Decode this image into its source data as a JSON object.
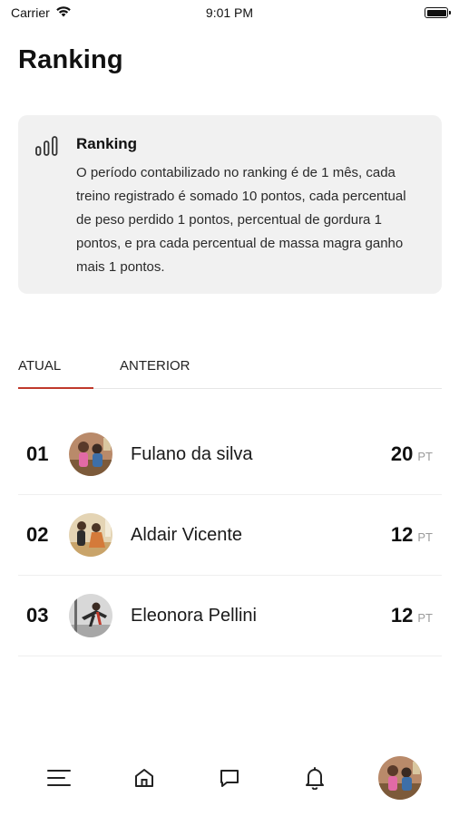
{
  "status_bar": {
    "carrier": "Carrier",
    "time": "9:01 PM"
  },
  "header": {
    "title": "Ranking"
  },
  "info_card": {
    "icon": "bar-chart-icon",
    "title": "Ranking",
    "body": "O período contabilizado no ranking é de 1 mês, cada treino registrado é somado 10 pontos, cada percentual de peso perdido 1 pontos, percentual de gordura 1 pontos, e pra cada percentual de massa magra ganho mais 1 pontos."
  },
  "tabs": [
    {
      "label": "ATUAL",
      "active": true
    },
    {
      "label": "ANTERIOR",
      "active": false
    }
  ],
  "ranking": [
    {
      "position": "01",
      "name": "Fulano da silva",
      "points": "20",
      "unit": "PT"
    },
    {
      "position": "02",
      "name": "Aldair Vicente",
      "points": "12",
      "unit": "PT"
    },
    {
      "position": "03",
      "name": "Eleonora Pellini",
      "points": "12",
      "unit": "PT"
    }
  ],
  "bottom_nav": [
    {
      "icon": "menu-icon"
    },
    {
      "icon": "home-icon"
    },
    {
      "icon": "chat-icon"
    },
    {
      "icon": "bell-icon"
    },
    {
      "icon": "profile-avatar"
    }
  ],
  "colors": {
    "accent": "#c0392b",
    "card_bg": "#f1f1f1",
    "unit_gray": "#9a9a9a"
  }
}
